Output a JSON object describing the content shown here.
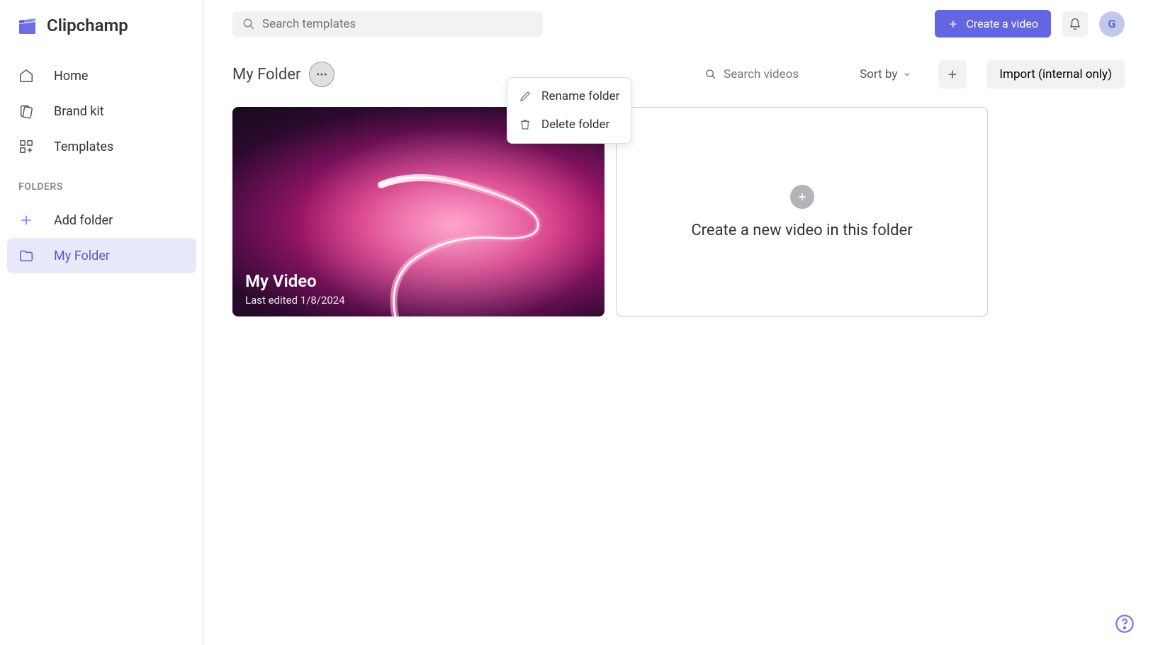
{
  "app": {
    "name": "Clipchamp",
    "avatar_initial": "G"
  },
  "topbar": {
    "search_placeholder": "Search templates",
    "create_video_label": "Create a video"
  },
  "sidebar": {
    "home_label": "Home",
    "brandkit_label": "Brand kit",
    "templates_label": "Templates",
    "folders_heading": "FOLDERS",
    "add_folder_label": "Add folder",
    "folders": [
      {
        "label": "My Folder"
      }
    ]
  },
  "content": {
    "folder_title": "My Folder",
    "search_videos_placeholder": "Search videos",
    "sort_by_label": "Sort by",
    "import_label": "Import (internal only)",
    "create_in_folder_label": "Create a new video in this folder"
  },
  "dropdown": {
    "rename_label": "Rename folder",
    "delete_label": "Delete folder"
  },
  "videos": [
    {
      "title": "My Video",
      "last_edited": "Last edited 1/8/2024"
    }
  ]
}
